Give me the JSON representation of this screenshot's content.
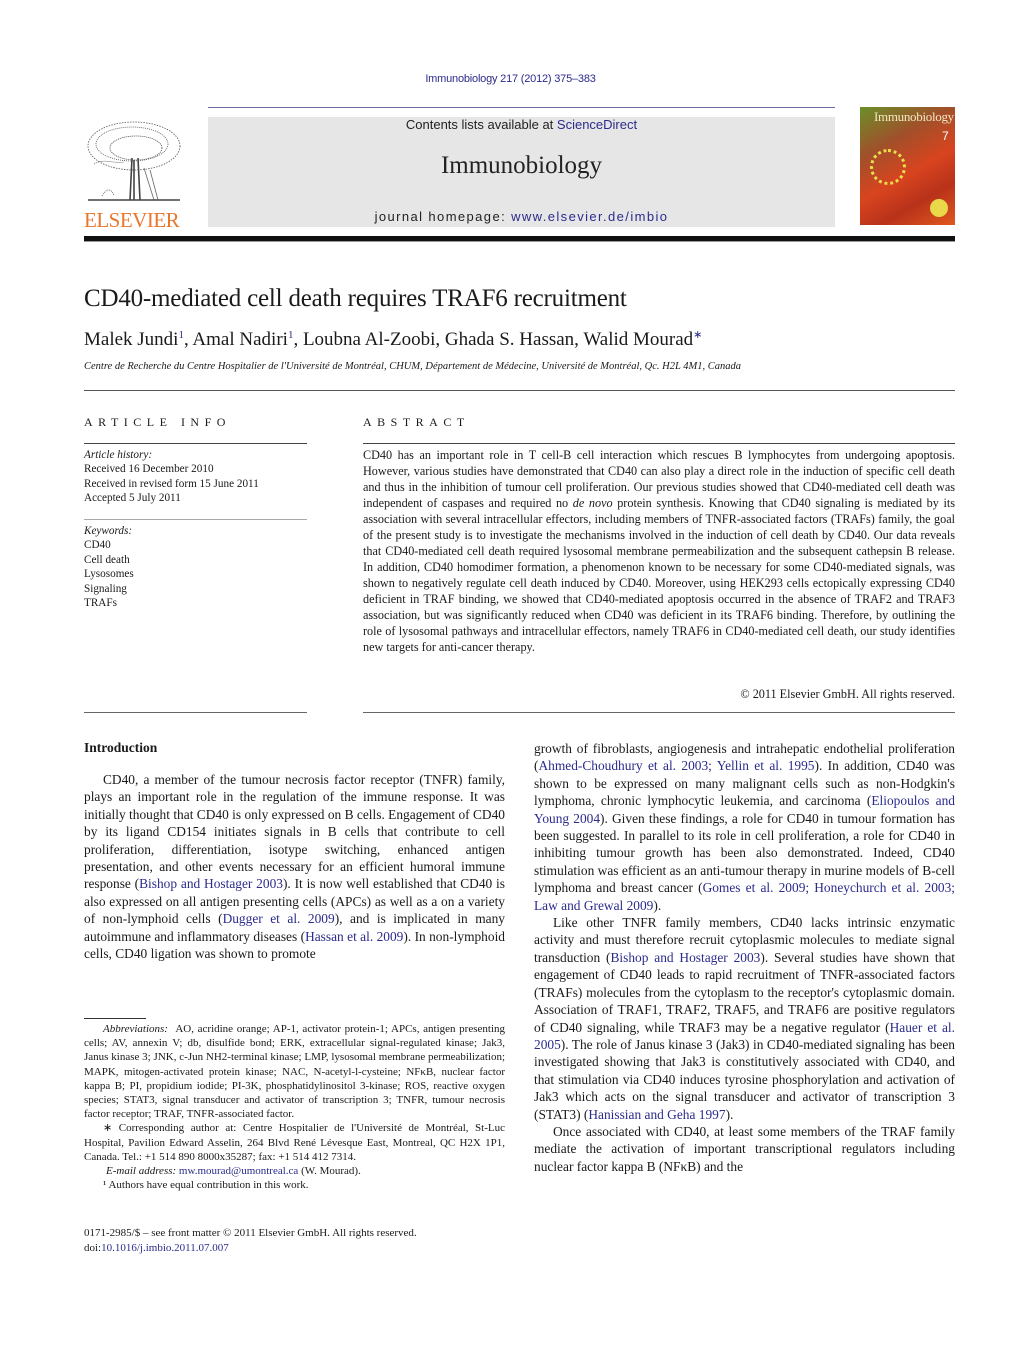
{
  "header": {
    "journal_ref": "Immunobiology 217 (2012) 375–383",
    "contents_prefix": "Contents lists available at ",
    "contents_link": "ScienceDirect",
    "journal_name": "Immunobiology",
    "homepage_prefix": "journal homepage: ",
    "homepage_link": "www.elsevier.de/imbio",
    "publisher_logo_text": "ELSEVIER",
    "cover_title": "Immunobiology",
    "cover_issue": "7",
    "colors": {
      "link": "#2b2b8c",
      "elsevier_orange": "#e8772e",
      "banner_bg": "#e6e6e6"
    }
  },
  "article": {
    "title": "CD40-mediated cell death requires TRAF6 recruitment",
    "authors": [
      {
        "name": "Malek Jundi",
        "mark": "1",
        "sep": ", "
      },
      {
        "name": "Amal Nadiri",
        "mark": "1",
        "sep": ", "
      },
      {
        "name": "Loubna Al-Zoobi",
        "mark": "",
        "sep": ", "
      },
      {
        "name": "Ghada S. Hassan",
        "mark": "",
        "sep": ", "
      },
      {
        "name": "Walid Mourad",
        "mark": "∗",
        "sep": ""
      }
    ],
    "affiliation": "Centre de Recherche du Centre Hospitalier de l'Université de Montréal, CHUM, Département de Médecine, Université de Montréal, Qc. H2L 4M1, Canada"
  },
  "article_info": {
    "label": "ARTICLE INFO",
    "history_label": "Article history:",
    "history": [
      "Received 16 December 2010",
      "Received in revised form 15 June 2011",
      "Accepted 5 July 2011"
    ],
    "keywords_label": "Keywords:",
    "keywords": [
      "CD40",
      "Cell death",
      "Lysosomes",
      "Signaling",
      "TRAFs"
    ]
  },
  "abstract": {
    "label": "ABSTRACT",
    "text_1": "CD40 has an important role in T cell-B cell interaction which rescues B lymphocytes from undergoing apoptosis. However, various studies have demonstrated that CD40 can also play a direct role in the induction of specific cell death and thus in the inhibition of tumour cell proliferation. Our previous studies showed that CD40-mediated cell death was independent of caspases and required no ",
    "text_italic": "de novo",
    "text_2": " protein synthesis. Knowing that CD40 signaling is mediated by its association with several intracellular effectors, including members of TNFR-associated factors (TRAFs) family, the goal of the present study is to investigate the mechanisms involved in the induction of cell death by CD40. Our data reveals that CD40-mediated cell death required lysosomal membrane permeabilization and the subsequent cathepsin B release. In addition, CD40 homodimer formation, a phenomenon known to be necessary for some CD40-mediated signals, was shown to negatively regulate cell death induced by CD40. Moreover, using HEK293 cells ectopically expressing CD40 deficient in TRAF binding, we showed that CD40-mediated apoptosis occurred in the absence of TRAF2 and TRAF3 association, but was significantly reduced when CD40 was deficient in its TRAF6 binding. Therefore, by outlining the role of lysosomal pathways and intracellular effectors, namely TRAF6 in CD40-mediated cell death, our study identifies new targets for anti-cancer therapy.",
    "copyright": "© 2011 Elsevier GmbH. All rights reserved."
  },
  "introduction": {
    "heading": "Introduction",
    "left": {
      "p1_a": "CD40, a member of the tumour necrosis factor receptor (TNFR) family, plays an important role in the regulation of the immune response. It was initially thought that CD40 is only expressed on B cells. Engagement of CD40 by its ligand CD154 initiates signals in B cells that contribute to cell proliferation, differentiation, isotype switching, enhanced antigen presentation, and other events necessary for an efficient humoral immune response (",
      "cite_1": "Bishop and Hostager 2003",
      "p1_b": "). It is now well established that CD40 is also expressed on all antigen presenting cells (APCs) as well as a on a variety of non-lymphoid cells (",
      "cite_2": "Dugger et al. 2009",
      "p1_c": "), and is implicated in many autoimmune and inflammatory diseases (",
      "cite_3": "Hassan et al. 2009",
      "p1_d": "). In non-lymphoid cells, CD40 ligation was shown to promote"
    },
    "right": {
      "p1_a": "growth of fibroblasts, angiogenesis and intrahepatic endothelial proliferation (",
      "cite_1": "Ahmed-Choudhury et al. 2003; Yellin et al. 1995",
      "p1_b": "). In addition, CD40 was shown to be expressed on many malignant cells such as non-Hodgkin's lymphoma, chronic lymphocytic leukemia, and carcinoma (",
      "cite_2": "Eliopoulos and Young 2004",
      "p1_c": "). Given these findings, a role for CD40 in tumour formation has been suggested. In parallel to its role in cell proliferation, a role for CD40 in inhibiting tumour growth has been also demonstrated. Indeed, CD40 stimulation was efficient as an anti-tumour therapy in murine models of B-cell lymphoma and breast cancer (",
      "cite_3": "Gomes et al. 2009; Honeychurch et al. 2003; Law and Grewal 2009",
      "p1_d": ").",
      "p2_a": "Like other TNFR family members, CD40 lacks intrinsic enzymatic activity and must therefore recruit cytoplasmic molecules to mediate signal transduction (",
      "cite_4": "Bishop and Hostager 2003",
      "p2_b": "). Several studies have shown that engagement of CD40 leads to rapid recruitment of TNFR-associated factors (TRAFs) molecules from the cytoplasm to the receptor's cytoplasmic domain. Association of TRAF1, TRAF2, TRAF5, and TRAF6 are positive regulators of CD40 signaling, while TRAF3 may be a negative regulator (",
      "cite_5": "Hauer et al. 2005",
      "p2_c": "). The role of Janus kinase 3 (Jak3) in CD40-mediated signaling has been investigated showing that Jak3 is constitutively associated with CD40, and that stimulation via CD40 induces tyrosine phosphorylation and activation of Jak3 which acts on the signal transducer and activator of transcription 3 (STAT3) (",
      "cite_6": "Hanissian and Geha 1997",
      "p2_d": ").",
      "p3": "Once associated with CD40, at least some members of the TRAF family mediate the activation of important transcriptional regulators including nuclear factor kappa B (NFκB) and the"
    }
  },
  "footnotes": {
    "abbrev_label": "Abbreviations:",
    "abbrev_text": "AO, acridine orange; AP-1, activator protein-1; APCs, antigen presenting cells; AV, annexin V; db, disulfide bond; ERK, extracellular signal-regulated kinase; Jak3, Janus kinase 3; JNK, c-Jun NH2-terminal kinase; LMP, lysosomal membrane permeabilization; MAPK, mitogen-activated protein kinase; NAC, N-acetyl-l-cysteine; NFκB, nuclear factor kappa B; PI, propidium iodide; PI-3K, phosphatidylinositol 3-kinase; ROS, reactive oxygen species; STAT3, signal transducer and activator of transcription 3; TNFR, tumour necrosis factor receptor; TRAF, TNFR-associated factor.",
    "corresponding": "∗ Corresponding author at: Centre Hospitalier de l'Université de Montréal, St-Luc Hospital, Pavilion Edward Asselin, 264 Blvd René Lévesque East, Montreal, QC H2X 1P1, Canada. Tel.: +1 514 890 8000x35287; fax: +1 514 412 7314.",
    "email_label": "E-mail address:",
    "email": "mw.mourad@umontreal.ca",
    "email_suffix": " (W. Mourad).",
    "equal_contrib": "¹ Authors have equal contribution in this work."
  },
  "frontmatter": {
    "issn_line": "0171-2985/$ – see front matter © 2011 Elsevier GmbH. All rights reserved.",
    "doi_prefix": "doi:",
    "doi": "10.1016/j.imbio.2011.07.007"
  }
}
